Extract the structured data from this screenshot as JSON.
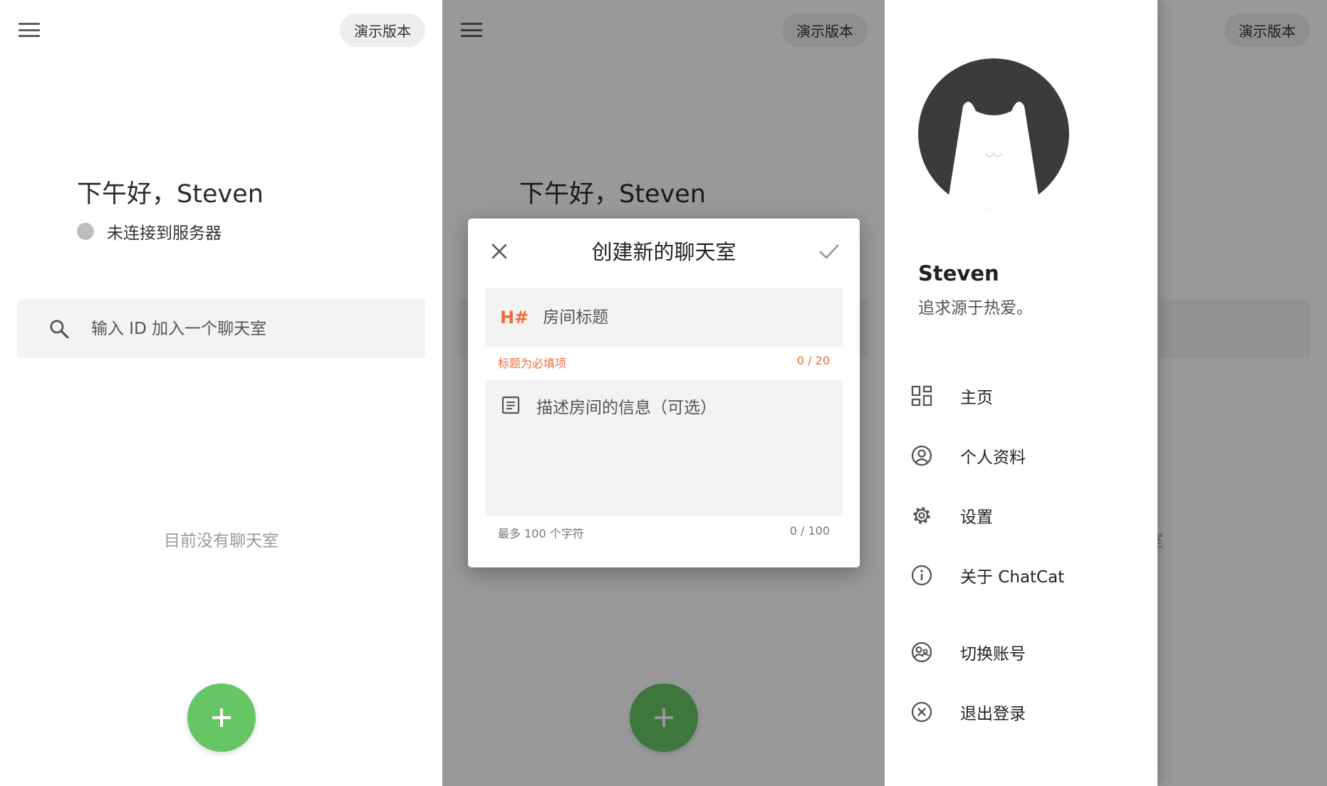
{
  "home": {
    "demo_chip": "演示版本",
    "greeting": "下午好，Steven",
    "status": "未连接到服务器",
    "search_placeholder": "输入 ID 加入一个聊天室",
    "empty_text": "目前没有聊天室"
  },
  "dialog": {
    "title": "创建新的聊天室",
    "title_icon_text": "H#",
    "title_placeholder": "房间标题",
    "title_error": "标题为必填项",
    "title_counter": "0 / 20",
    "desc_placeholder": "描述房间的信息（可选）",
    "desc_hint": "最多 100 个字符",
    "desc_counter": "0 / 100"
  },
  "drawer": {
    "name": "Steven",
    "bio": "追求源于热爱。",
    "items": [
      {
        "label": "主页",
        "icon": "dashboard-icon"
      },
      {
        "label": "个人资料",
        "icon": "account-circle-icon"
      },
      {
        "label": "设置",
        "icon": "gear-icon"
      },
      {
        "label": "关于 ChatCat",
        "icon": "info-icon"
      },
      {
        "label": "切换账号",
        "icon": "switch-account-icon"
      },
      {
        "label": "退出登录",
        "icon": "logout-icon"
      }
    ]
  },
  "colors": {
    "accent_green": "#66c666",
    "error_orange": "#f26b3a",
    "status_gray": "#bdbdbd",
    "avatar_dark": "#3b3b3b"
  }
}
